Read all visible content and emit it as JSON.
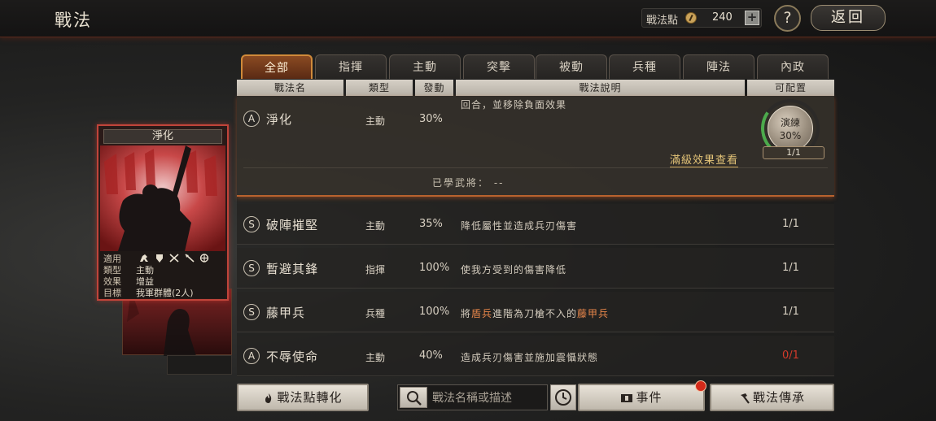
{
  "header": {
    "title": "戰法",
    "points_label": "戰法點",
    "points_value": "240",
    "plus_label": "+",
    "help_label": "?",
    "back_label": "返回"
  },
  "card": {
    "title": "淨化",
    "rows": [
      {
        "key": "適用",
        "value": ""
      },
      {
        "key": "類型",
        "value": "主動"
      },
      {
        "key": "效果",
        "value": "增益"
      },
      {
        "key": "目標",
        "value": "我軍群體(2人)"
      }
    ],
    "type_icons": [
      "cavalry-icon",
      "shield-icon",
      "crossbow-icon",
      "spear-icon",
      "siege-icon"
    ]
  },
  "tabs": [
    "全部",
    "指揮",
    "主動",
    "突擊",
    "被動",
    "兵種",
    "陣法",
    "內政"
  ],
  "table": {
    "headers": [
      "戰法名",
      "類型",
      "發動",
      "戰法說明",
      "可配置"
    ],
    "expanded": {
      "grade": "A",
      "name": "淨化",
      "type": "主動",
      "rate": "30%",
      "desc": "回合，並移除負面效果",
      "train_label": "演練",
      "train_percent": "30%",
      "train_count": "1/1",
      "full_effect_link": "滿級效果查看",
      "learned": "已學武將：  --"
    },
    "rows": [
      {
        "grade": "S",
        "name": "破陣摧堅",
        "type": "主動",
        "rate": "35%",
        "desc": "降低屬性並造成兵刃傷害",
        "alloc": "1/1"
      },
      {
        "grade": "S",
        "name": "暫避其鋒",
        "type": "指揮",
        "rate": "100%",
        "desc": "使我方受到的傷害降低",
        "alloc": "1/1"
      },
      {
        "grade": "S",
        "name": "藤甲兵",
        "type": "兵種",
        "rate": "100%",
        "desc_parts": [
          "將",
          "盾兵",
          "進階為刀槍不入的",
          "藤甲兵"
        ],
        "alloc": "1/1"
      },
      {
        "grade": "A",
        "name": "不辱使命",
        "type": "主動",
        "rate": "40%",
        "desc": "造成兵刃傷害並施加震懾狀態",
        "alloc": "0/1"
      }
    ]
  },
  "footer": {
    "convert_label": "戰法點轉化",
    "search_placeholder": "戰法名稱或描述",
    "event_label": "事件",
    "inherit_label": "戰法傳承"
  },
  "colors": {
    "accent_orange": "#d08a3a",
    "highlight_text": "#e8874a",
    "alert_red": "#d43a2a",
    "progress_green": "#4caa4c"
  }
}
